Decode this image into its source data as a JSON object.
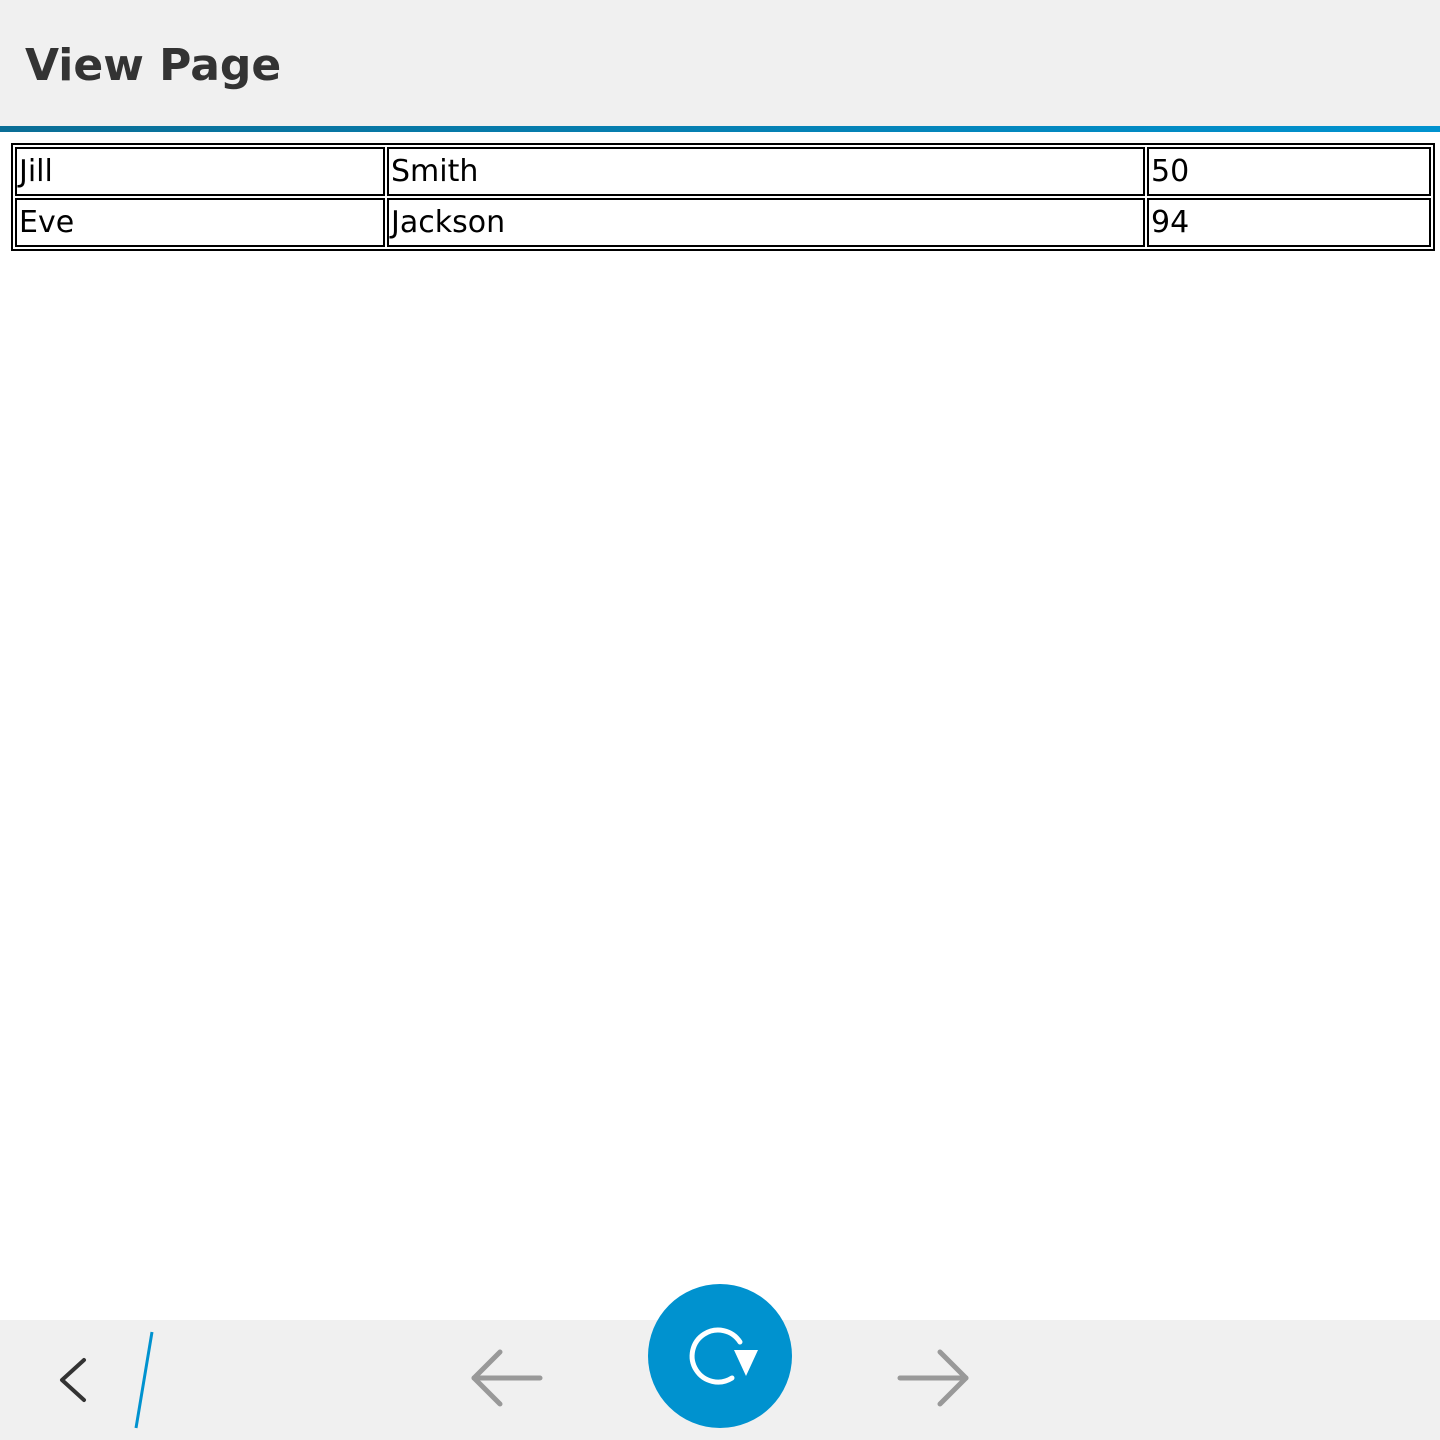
{
  "title_bar": {
    "title": "View Page"
  },
  "table": {
    "rows": [
      [
        "Jill",
        "Smith",
        "50"
      ],
      [
        "Eve",
        "Jackson",
        "94"
      ]
    ]
  },
  "action_bar": {
    "back_icon": "chevron-left-icon",
    "prev_icon": "arrow-left-icon",
    "reload_icon": "reload-icon",
    "next_icon": "arrow-right-icon"
  },
  "colors": {
    "accent": "#0092cf",
    "bar_background": "#f0f0f0",
    "title_text": "#333333"
  }
}
